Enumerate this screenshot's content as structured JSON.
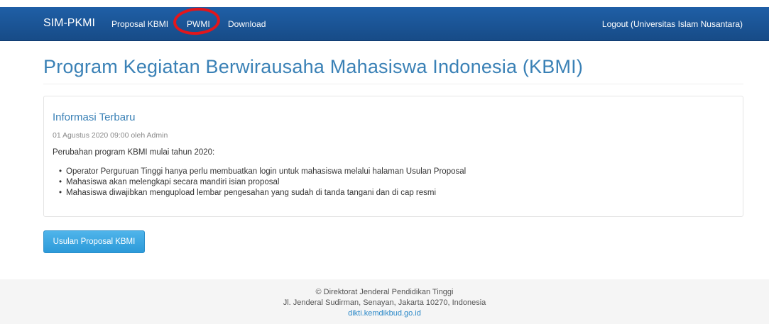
{
  "navbar": {
    "brand": "SIM-PKMI",
    "items": [
      {
        "label": "Proposal KBMI"
      },
      {
        "label": "PWMI"
      },
      {
        "label": "Download"
      }
    ],
    "logout": "Logout (Universitas Islam Nusantara)"
  },
  "page": {
    "title": "Program Kegiatan Berwirausaha Mahasiswa Indonesia (KBMI)"
  },
  "panel": {
    "heading": "Informasi Terbaru",
    "meta": "01 Agustus 2020 09:00 oleh Admin",
    "intro": "Perubahan program KBMI mulai tahun 2020:",
    "items": [
      "Operator Perguruan Tinggi hanya perlu membuatkan login untuk mahasiswa melalui halaman Usulan Proposal",
      "Mahasiswa akan melengkapi secara mandiri isian proposal",
      "Mahasiswa diwajibkan mengupload lembar pengesahan yang sudah di tanda tangani dan di cap resmi"
    ]
  },
  "actions": {
    "usulan_button": "Usulan Proposal KBMI"
  },
  "footer": {
    "line1": "© Direktorat Jenderal Pendidikan Tinggi",
    "line2": "Jl. Jenderal Sudirman, Senayan, Jakarta 10270, Indonesia",
    "link": "dikti.kemdikbud.go.id"
  },
  "colors": {
    "navbar": "#1f5fa6",
    "accent": "#3a81b6",
    "button": "#2c9ad9",
    "highlight": "#e3161b"
  }
}
